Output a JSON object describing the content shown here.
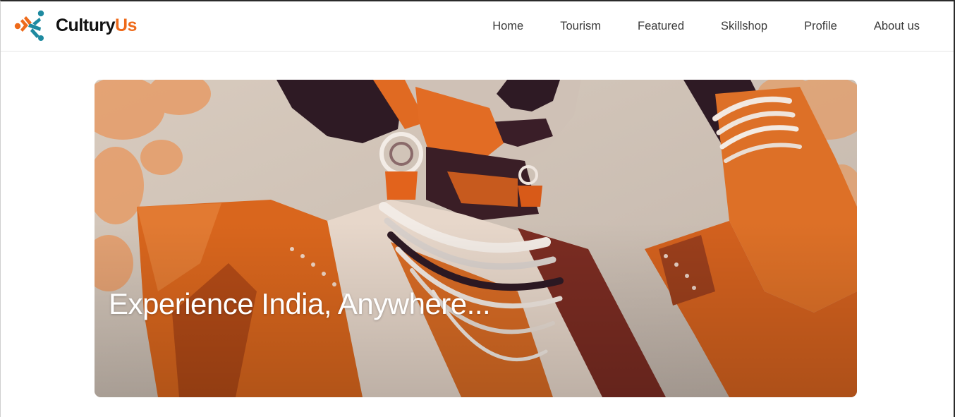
{
  "brand": {
    "name_part1": "Cultury",
    "name_part2": "Us",
    "logo_icon": "people-connect-icon",
    "colors": {
      "dark": "#111111",
      "accent": "#ee6a1a",
      "teal": "#1e8aa0"
    }
  },
  "nav": {
    "items": [
      {
        "label": "Home"
      },
      {
        "label": "Tourism"
      },
      {
        "label": "Featured"
      },
      {
        "label": "Skillshop"
      },
      {
        "label": "Profile"
      },
      {
        "label": "About us"
      }
    ]
  },
  "hero": {
    "title": "Experience India, Anywhere..."
  }
}
